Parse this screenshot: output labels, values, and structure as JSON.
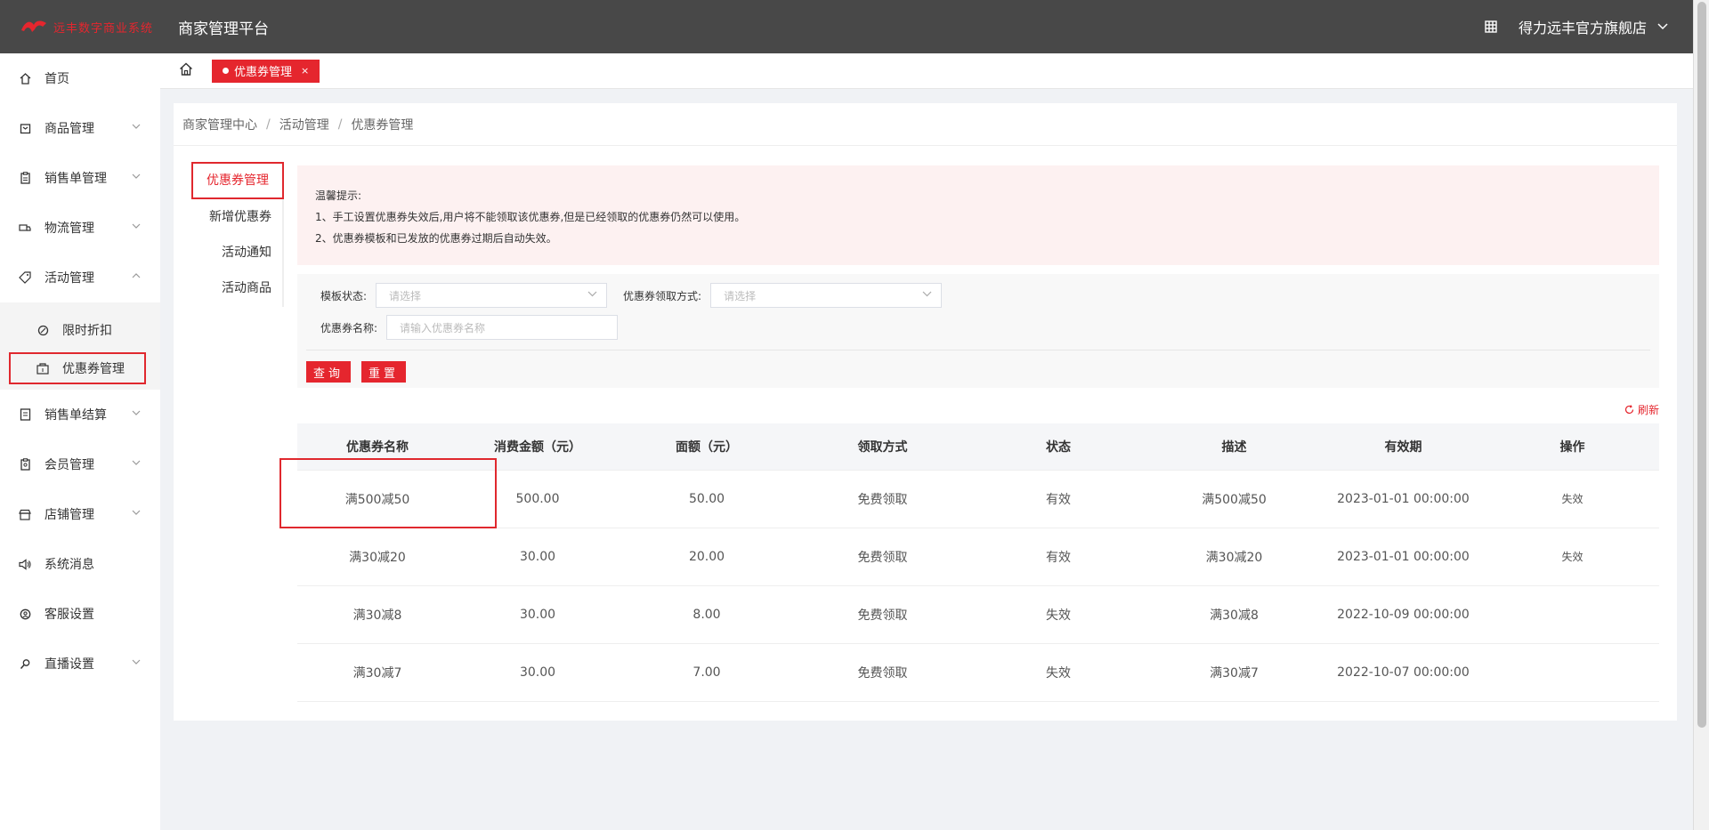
{
  "header": {
    "logo_text": "远丰数字商业系统",
    "platform_title": "商家管理平台",
    "user_name": "得力远丰官方旗舰店",
    "grid_icon": "qr-grid-icon"
  },
  "sidebar": {
    "items": [
      {
        "label": "首页",
        "icon": "home-icon"
      },
      {
        "label": "商品管理",
        "icon": "box-icon"
      },
      {
        "label": "销售单管理",
        "icon": "clipboard-icon"
      },
      {
        "label": "物流管理",
        "icon": "truck-icon"
      },
      {
        "label": "活动管理",
        "icon": "tag-icon"
      },
      {
        "label": "销售单结算",
        "icon": "ledger-icon"
      },
      {
        "label": "会员管理",
        "icon": "member-icon"
      },
      {
        "label": "店铺管理",
        "icon": "shop-icon"
      },
      {
        "label": "系统消息",
        "icon": "speaker-icon"
      },
      {
        "label": "客服设置",
        "icon": "service-icon"
      },
      {
        "label": "直播设置",
        "icon": "live-icon"
      }
    ],
    "sub_items": [
      {
        "label": "限时折扣",
        "icon": "discount-icon"
      },
      {
        "label": "优惠券管理",
        "icon": "coupon-icon"
      }
    ]
  },
  "tabs": {
    "active_label": "优惠券管理",
    "close": "×"
  },
  "breadcrumb": [
    "商家管理中心",
    "活动管理",
    "优惠券管理"
  ],
  "subnav": [
    "优惠券管理",
    "新增优惠券",
    "活动通知",
    "活动商品"
  ],
  "tip": {
    "title": "温馨提示:",
    "line1": "1、手工设置优惠券失效后,用户将不能领取该优惠券,但是已经领取的优惠券仍然可以使用。",
    "line2": "2、优惠券模板和已发放的优惠券过期后自动失效。"
  },
  "filter": {
    "template_status_label": "模板状态:",
    "template_status_placeholder": "请选择",
    "receive_method_label": "优惠券领取方式:",
    "receive_method_placeholder": "请选择",
    "coupon_name_label": "优惠券名称:",
    "coupon_name_placeholder": "请输入优惠券名称",
    "query_button": "查询",
    "reset_button": "重置"
  },
  "refresh_label": "刷新",
  "table": {
    "headers": [
      "优惠券名称",
      "消费金额（元）",
      "面额（元）",
      "领取方式",
      "状态",
      "描述",
      "有效期",
      "操作"
    ],
    "rows": [
      [
        "满500减50",
        "500.00",
        "50.00",
        "免费领取",
        "有效",
        "满500减50",
        "2023-01-01 00:00:00",
        "失效"
      ],
      [
        "满30减20",
        "30.00",
        "20.00",
        "免费领取",
        "有效",
        "满30减20",
        "2023-01-01 00:00:00",
        "失效"
      ],
      [
        "满30减8",
        "30.00",
        "8.00",
        "免费领取",
        "失效",
        "满30减8",
        "2022-10-09 00:00:00",
        ""
      ],
      [
        "满30减7",
        "30.00",
        "7.00",
        "免费领取",
        "失效",
        "满30减7",
        "2022-10-07 00:00:00",
        ""
      ]
    ]
  },
  "colors": {
    "accent": "#e5262e",
    "header_bg": "#484848"
  }
}
